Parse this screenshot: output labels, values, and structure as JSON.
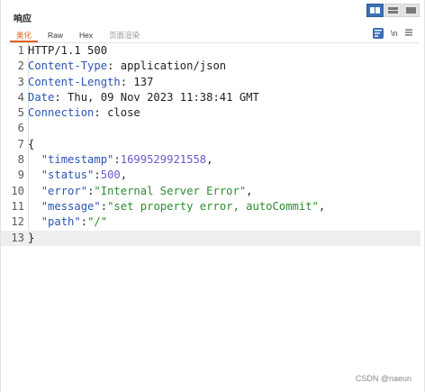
{
  "panel": {
    "title": "响应",
    "view_toggle": [
      {
        "icon": "split-columns-icon",
        "active": true
      },
      {
        "icon": "split-rows-icon",
        "active": false
      },
      {
        "icon": "single-pane-icon",
        "active": false
      }
    ]
  },
  "tabs": [
    {
      "label": "美化",
      "active": true
    },
    {
      "label": "Raw",
      "active": false
    },
    {
      "label": "Hex",
      "active": false
    },
    {
      "label": "页面渲染",
      "active": false
    }
  ],
  "tools": {
    "wrap_icon": "word-wrap-icon",
    "newline_label": "\\n",
    "menu_icon": "hamburger-menu-icon"
  },
  "editor": {
    "line_numbers": [
      "1",
      "2",
      "3",
      "4",
      "5",
      "6",
      "7",
      "8",
      "9",
      "10",
      "11",
      "12",
      "13"
    ],
    "status_line": "HTTP/1.1 500",
    "headers": [
      {
        "name": "Content-Type",
        "value": "application/json"
      },
      {
        "name": "Content-Length",
        "value": "137"
      },
      {
        "name": "Date",
        "value": "Thu, 09 Nov 2023 11:38:41 GMT"
      },
      {
        "name": "Connection",
        "value": "close"
      }
    ],
    "open_brace": "{",
    "close_brace": "}",
    "body": [
      {
        "key": "\"timestamp\"",
        "value": "1699529921558",
        "type": "number",
        "suffix": ","
      },
      {
        "key": "\"status\"",
        "value": "500",
        "type": "number",
        "suffix": ","
      },
      {
        "key": "\"error\"",
        "value": "\"Internal Server Error\"",
        "type": "string",
        "suffix": ","
      },
      {
        "key": "\"message\"",
        "value": "\"set property error, autoCommit\"",
        "type": "string",
        "suffix": ","
      },
      {
        "key": "\"path\"",
        "value": "\"/\"",
        "type": "string",
        "suffix": ""
      }
    ]
  },
  "watermark": "CSDN @naeun"
}
